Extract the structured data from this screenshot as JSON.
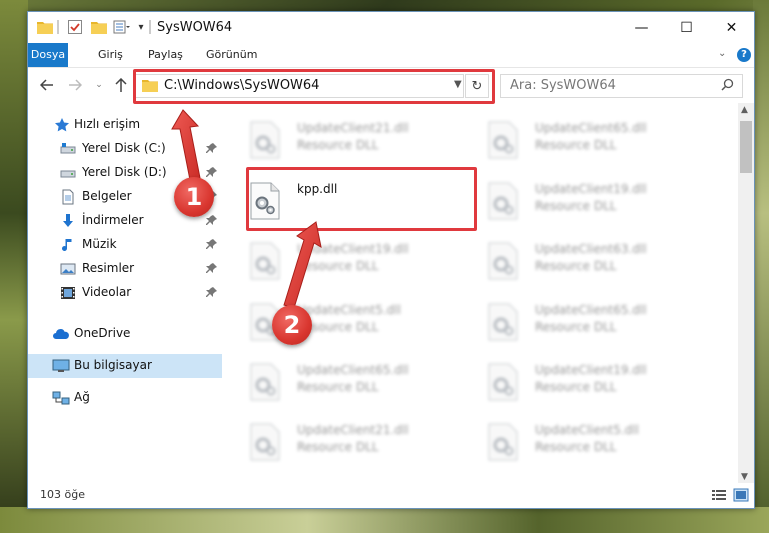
{
  "window": {
    "title": "SysWOW64",
    "controls": {
      "minimize": "—",
      "maximize": "☐",
      "close": "✕"
    }
  },
  "ribbon": {
    "tabs": [
      "Dosya",
      "Giriş",
      "Paylaş",
      "Görünüm"
    ],
    "active_tab": "Dosya",
    "help": "?"
  },
  "address_bar": {
    "path": "C:\\Windows\\SysWOW64",
    "search_placeholder": "Ara: SysWOW64"
  },
  "nav_pane": {
    "items": [
      {
        "label": "Hızlı erişim",
        "icon": "star-icon"
      },
      {
        "label": "Yerel Disk (C:)",
        "icon": "drive-icon",
        "pinned": true
      },
      {
        "label": "Yerel Disk (D:)",
        "icon": "drive-icon",
        "pinned": true
      },
      {
        "label": "Belgeler",
        "icon": "documents-icon",
        "pinned": true
      },
      {
        "label": "İndirmeler",
        "icon": "download-icon",
        "pinned": true
      },
      {
        "label": "Müzik",
        "icon": "music-icon",
        "pinned": true
      },
      {
        "label": "Resimler",
        "icon": "pictures-icon",
        "pinned": true
      },
      {
        "label": "Videolar",
        "icon": "videos-icon",
        "pinned": true
      },
      {
        "label": "OneDrive",
        "icon": "cloud-icon"
      },
      {
        "label": "Bu bilgisayar",
        "icon": "computer-icon",
        "selected": true
      },
      {
        "label": "Ağ",
        "icon": "network-icon"
      }
    ]
  },
  "files": {
    "left": [
      {
        "name": "UpdateClient21.dll",
        "type": "Resource DLL"
      },
      {
        "name": "kpp.dll",
        "type": ""
      },
      {
        "name": "UpdateClient19.dll",
        "type": "Resource DLL"
      },
      {
        "name": "UpdateClient5.dll",
        "type": "Resource DLL"
      },
      {
        "name": "UpdateClient65.dll",
        "type": "Resource DLL"
      },
      {
        "name": "UpdateClient21.dll",
        "type": "Resource DLL"
      }
    ],
    "right": [
      {
        "name": "UpdateClient65.dll",
        "type": "Resource DLL"
      },
      {
        "name": "UpdateClient19.dll",
        "type": "Resource DLL"
      },
      {
        "name": "UpdateClient63.dll",
        "type": "Resource DLL"
      },
      {
        "name": "UpdateClient65.dll",
        "type": "Resource DLL"
      },
      {
        "name": "UpdateClient19.dll",
        "type": "Resource DLL"
      },
      {
        "name": "UpdateClient5.dll",
        "type": "Resource DLL"
      }
    ]
  },
  "status": {
    "item_count": "103 öğe"
  },
  "callouts": [
    "1",
    "2"
  ],
  "colors": {
    "accent": "#1979ca",
    "highlight": "#e0393e",
    "selected_bg": "#cce4f7"
  }
}
